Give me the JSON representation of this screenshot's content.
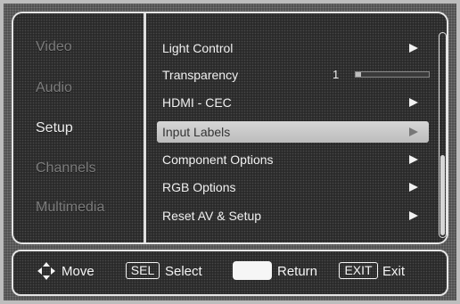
{
  "sidebar": {
    "items": [
      {
        "label": "Video",
        "active": false
      },
      {
        "label": "Audio",
        "active": false
      },
      {
        "label": "Setup",
        "active": true
      },
      {
        "label": "Channels",
        "active": false
      },
      {
        "label": "Multimedia",
        "active": false
      }
    ]
  },
  "menu": {
    "items": [
      {
        "label": "Light Control",
        "arrow": "right-arrow-icon"
      },
      {
        "label": "Transparency",
        "value": "1",
        "level": 0.07
      },
      {
        "label": "HDMI - CEC",
        "arrow": "right-arrow-icon"
      },
      {
        "label": "Input Labels",
        "arrow": "right-arrow-icon",
        "selected": true
      },
      {
        "label": "Component Options",
        "arrow": "right-arrow-icon"
      },
      {
        "label": "RGB Options",
        "arrow": "right-arrow-icon"
      },
      {
        "label": "Reset AV & Setup",
        "arrow": "right-arrow-icon"
      }
    ]
  },
  "footer": {
    "move_label": "Move",
    "sel_key": "SEL",
    "select_label": "Select",
    "return_label": "Return",
    "exit_key": "EXIT",
    "exit_label": "Exit"
  },
  "colors": {
    "selected_bg": "#c9c9c9",
    "text": "#f0f0f0",
    "inactive_text": "#7b7b7b"
  }
}
